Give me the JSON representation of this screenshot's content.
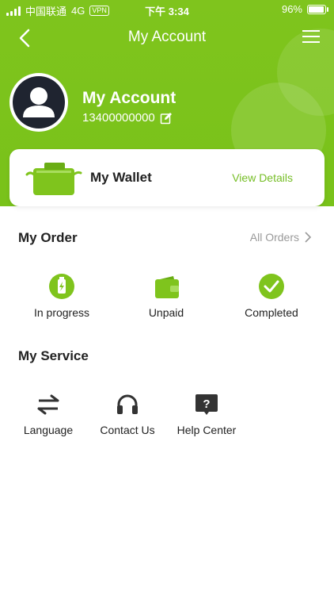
{
  "status_bar": {
    "carrier": "中国联通",
    "network": "4G",
    "vpn": "VPN",
    "time": "下午 3:34",
    "battery": "96%",
    "battery_level": 0.96
  },
  "nav": {
    "title": "My Account",
    "back_icon": "back-arrow-icon",
    "menu_icon": "hamburger-menu-icon"
  },
  "account": {
    "name": "My Account",
    "phone": "13400000000",
    "avatar_icon": "user-avatar-icon",
    "edit_icon": "edit-icon"
  },
  "wallet": {
    "title": "My Wallet",
    "link": "View Details",
    "icon": "wallet-icon"
  },
  "orders": {
    "title": "My Order",
    "all_label": "All Orders",
    "items": [
      {
        "label": "In progress",
        "icon": "in-progress-icon"
      },
      {
        "label": "Unpaid",
        "icon": "wallet-unpaid-icon"
      },
      {
        "label": "Completed",
        "icon": "check-circle-icon"
      }
    ]
  },
  "services": {
    "title": "My Service",
    "items": [
      {
        "label": "Language",
        "icon": "swap-arrows-icon"
      },
      {
        "label": "Contact Us",
        "icon": "headphones-icon"
      },
      {
        "label": "Help Center",
        "icon": "help-icon"
      }
    ]
  },
  "colors": {
    "brand": "#79c21a",
    "accent": "#76be26",
    "text": "#222222",
    "muted": "#999999"
  }
}
